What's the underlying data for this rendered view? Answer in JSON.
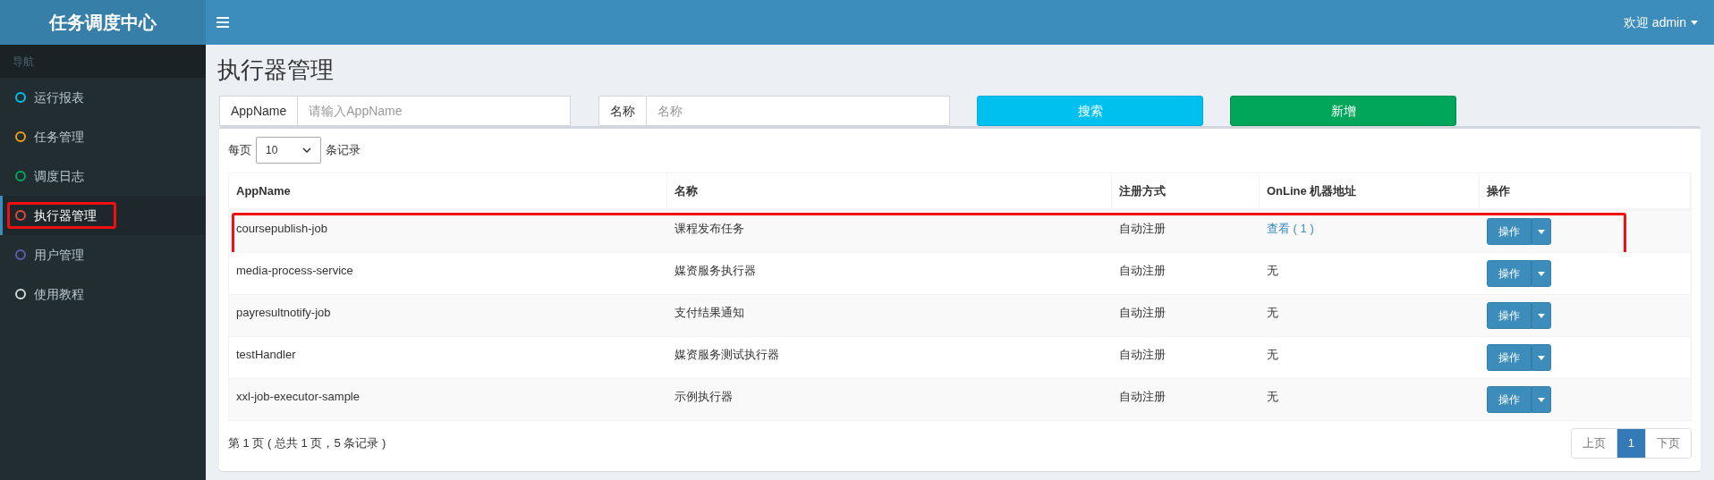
{
  "brand": "任务调度中心",
  "header": {
    "user": "欢迎 admin"
  },
  "sidebar": {
    "heading": "导航",
    "items": [
      {
        "label": "运行报表",
        "color": "#00c0ef",
        "selected": false,
        "highlighted": false
      },
      {
        "label": "任务管理",
        "color": "#f39c12",
        "selected": false,
        "highlighted": false
      },
      {
        "label": "调度日志",
        "color": "#00a65a",
        "selected": false,
        "highlighted": false
      },
      {
        "label": "执行器管理",
        "color": "#dd4b39",
        "selected": true,
        "highlighted": true
      },
      {
        "label": "用户管理",
        "color": "#605ca8",
        "selected": false,
        "highlighted": false
      },
      {
        "label": "使用教程",
        "color": "#d2d6de",
        "selected": false,
        "highlighted": false
      }
    ]
  },
  "page_title": "执行器管理",
  "filters": [
    {
      "label": "AppName",
      "placeholder": "请输入AppName"
    },
    {
      "label": "名称",
      "placeholder": "名称"
    }
  ],
  "buttons": [
    {
      "label": "搜索",
      "kind": "info"
    },
    {
      "label": "新增",
      "kind": "success"
    }
  ],
  "page_size": {
    "before": "每页",
    "value": "10",
    "after": "条记录"
  },
  "table": {
    "columns": [
      "AppName",
      "名称",
      "注册方式",
      "OnLine 机器地址",
      "操作"
    ],
    "rows": [
      {
        "app": "coursepublish-job",
        "name": "课程发布任务",
        "registration": "自动注册",
        "online": "查看 ( 1 )",
        "link": true,
        "action": "操作",
        "highlighted": true
      },
      {
        "app": "media-process-service",
        "name": "媒资服务执行器",
        "registration": "自动注册",
        "online": "无",
        "link": false,
        "action": "操作",
        "highlighted": false
      },
      {
        "app": "payresultnotify-job",
        "name": "支付结果通知",
        "registration": "自动注册",
        "online": "无",
        "link": false,
        "action": "操作",
        "highlighted": false
      },
      {
        "app": "testHandler",
        "name": "媒资服务测试执行器",
        "registration": "自动注册",
        "online": "无",
        "link": false,
        "action": "操作",
        "highlighted": false
      },
      {
        "app": "xxl-job-executor-sample",
        "name": "示例执行器",
        "registration": "自动注册",
        "online": "无",
        "link": false,
        "action": "操作",
        "highlighted": false
      }
    ]
  },
  "summary": "第 1 页 ( 总共 1 页，5 条记录 )",
  "pagination": [
    {
      "label": "上页",
      "selected": false
    },
    {
      "label": "1",
      "selected": true
    },
    {
      "label": "下页",
      "selected": false
    }
  ]
}
